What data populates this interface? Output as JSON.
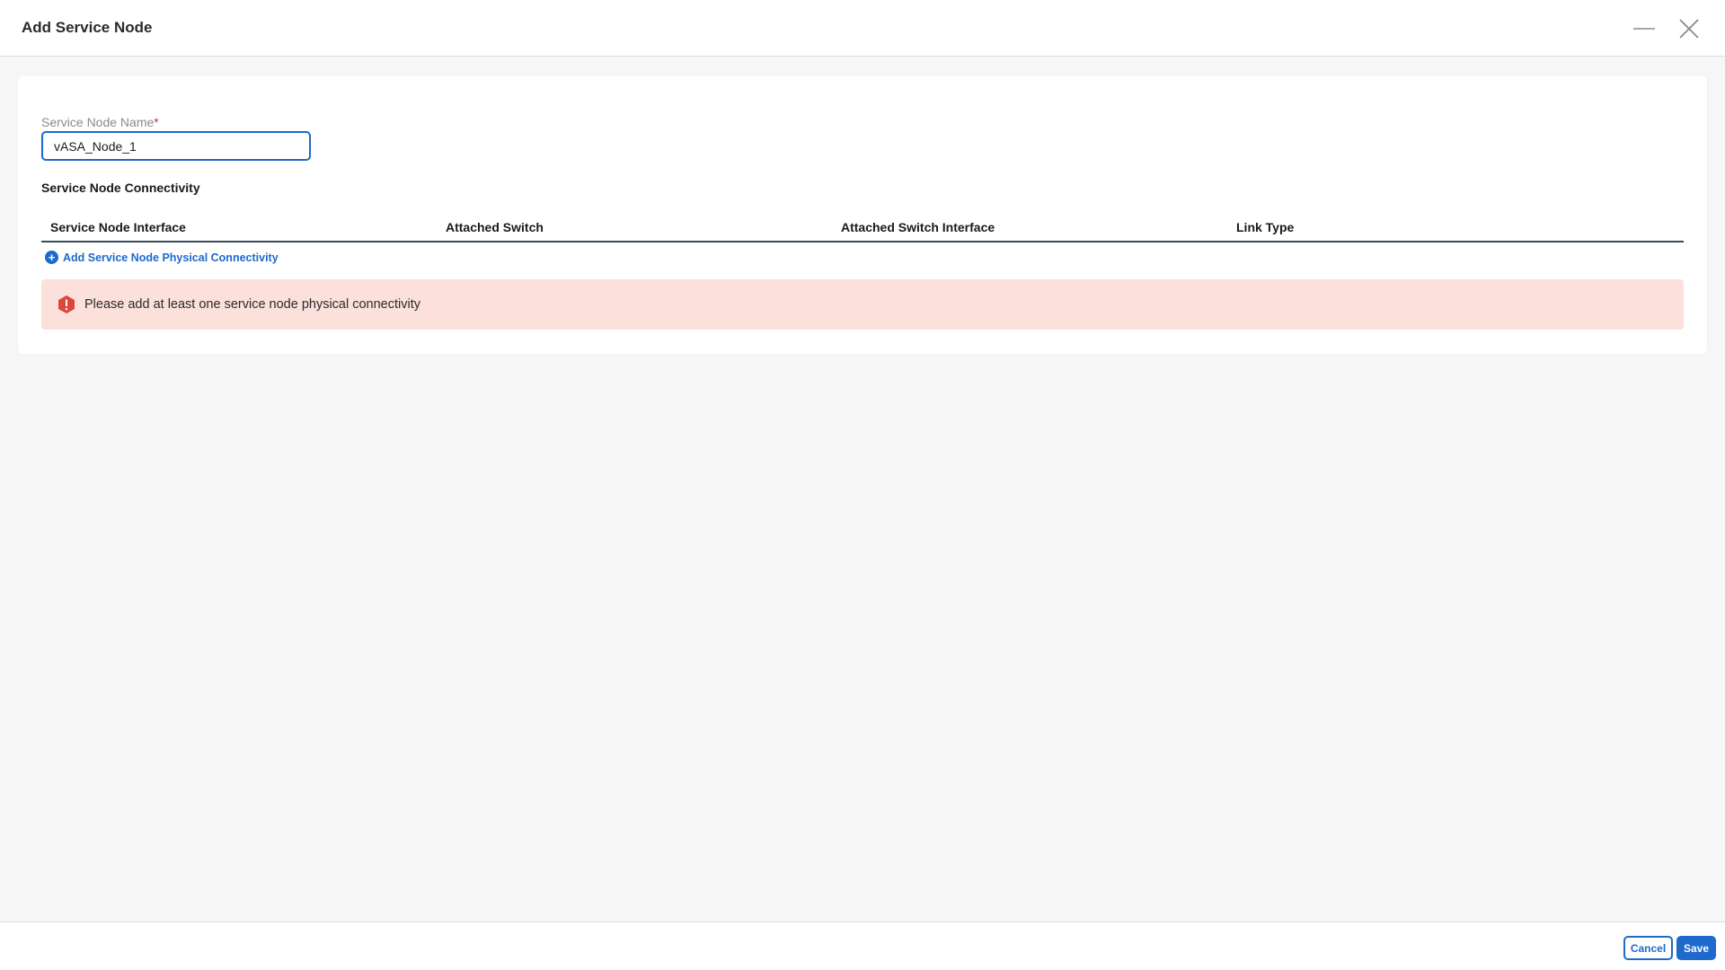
{
  "modal": {
    "title": "Add Service Node"
  },
  "form": {
    "name_label": "Service Node Name",
    "required_marker": "*",
    "name_value": "vASA_Node_1"
  },
  "connectivity": {
    "section_title": "Service Node Connectivity",
    "columns": [
      "Service Node Interface",
      "Attached Switch",
      "Attached Switch Interface",
      "Link Type"
    ],
    "add_link_label": "Add Service Node Physical Connectivity",
    "add_icon": "plus-circle-icon"
  },
  "alert": {
    "icon": "error-hexagon-icon",
    "message": "Please add at least one service node physical connectivity"
  },
  "footer": {
    "cancel_label": "Cancel",
    "save_label": "Save"
  },
  "colors": {
    "accent": "#1d69cc",
    "alert_bg": "#fbe0dc",
    "error": "#d9483b"
  }
}
